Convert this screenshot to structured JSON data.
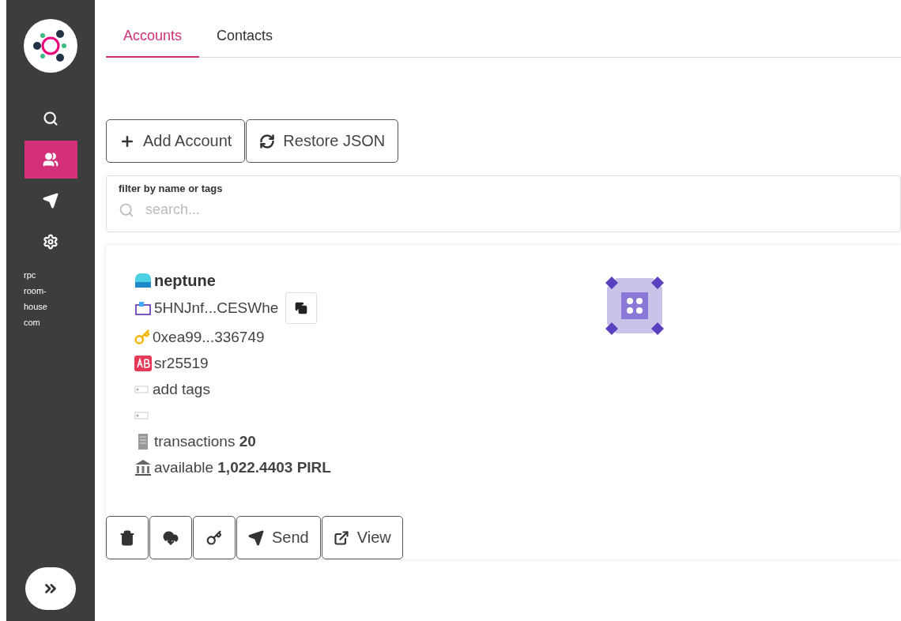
{
  "sidebar": {
    "items": [
      {
        "kind": "search",
        "selected": false
      },
      {
        "kind": "accounts",
        "selected": true
      },
      {
        "kind": "send",
        "selected": false
      },
      {
        "kind": "settings",
        "selected": false
      }
    ],
    "node_lines": [
      "rpc",
      "room-",
      "house",
      "com"
    ]
  },
  "tabs": [
    {
      "label": "Accounts",
      "selected": true
    },
    {
      "label": "Contacts",
      "selected": false
    }
  ],
  "actions": [
    {
      "kind": "add",
      "label": "Add Account"
    },
    {
      "kind": "restore",
      "label": "Restore JSON"
    }
  ],
  "filter": {
    "label": "filter by name or tags",
    "placeholder": "search..."
  },
  "account": {
    "name": "neptune",
    "address": "5HNJnf...CESWhe",
    "evm_address": "0xea99...336749",
    "crypto_type": "sr25519",
    "tags_placeholder": "add tags",
    "transactions": {
      "label": "transactions",
      "value": "20"
    },
    "available": {
      "label": "available",
      "value": "1,022.4403 PIRL"
    },
    "buttons": [
      {
        "kind": "delete"
      },
      {
        "kind": "backup"
      },
      {
        "kind": "password"
      },
      {
        "kind": "send",
        "label": "Send"
      },
      {
        "kind": "view",
        "label": "View"
      }
    ]
  }
}
